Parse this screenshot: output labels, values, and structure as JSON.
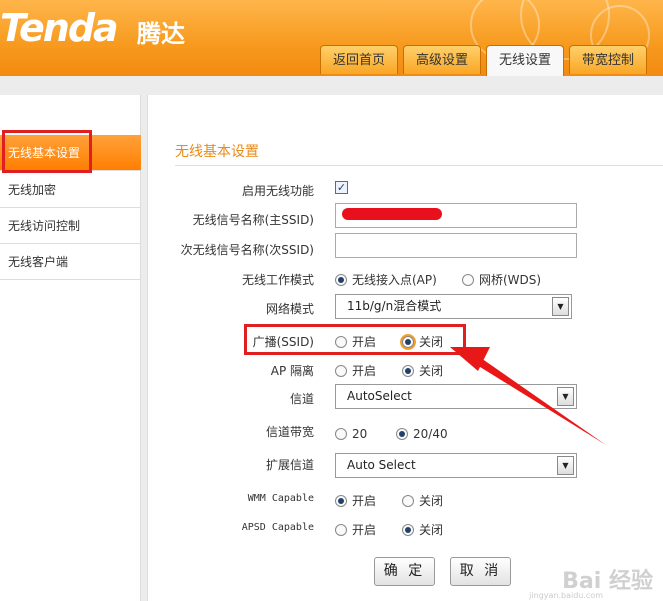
{
  "header": {
    "logo": "Tenda",
    "logo_cn": "腾达",
    "tabs": [
      "返回首页",
      "高级设置",
      "无线设置",
      "带宽控制"
    ],
    "active_tab": "无线设置"
  },
  "sidebar": {
    "items": [
      "无线基本设置",
      "无线加密",
      "无线访问控制",
      "无线客户端"
    ],
    "active": "无线基本设置"
  },
  "main": {
    "title": "无线基本设置",
    "enable_wireless": {
      "label": "启用无线功能",
      "checked": true,
      "mark": "✓"
    },
    "ssid_primary": {
      "label": "无线信号名称(主SSID)",
      "value": ""
    },
    "ssid_secondary": {
      "label": "次无线信号名称(次SSID)",
      "value": ""
    },
    "work_mode": {
      "label": "无线工作模式",
      "options": [
        "无线接入点(AP)",
        "网桥(WDS)"
      ],
      "selected": "无线接入点(AP)"
    },
    "network_mode": {
      "label": "网络模式",
      "value": "11b/g/n混合模式"
    },
    "broadcast": {
      "label": "广播(SSID)",
      "options": [
        "开启",
        "关闭"
      ],
      "selected": "关闭"
    },
    "ap_isolation": {
      "label": "AP 隔离",
      "options": [
        "开启",
        "关闭"
      ],
      "selected": "关闭"
    },
    "channel": {
      "label": "信道",
      "value": "AutoSelect"
    },
    "bandwidth": {
      "label": "信道带宽",
      "options": [
        "20",
        "20/40"
      ],
      "selected": "20/40"
    },
    "ext_channel": {
      "label": "扩展信道",
      "value": "Auto Select"
    },
    "wmm": {
      "label": "WMM Capable",
      "options": [
        "开启",
        "关闭"
      ],
      "selected": "开启"
    },
    "apsd": {
      "label": "APSD Capable",
      "options": [
        "开启",
        "关闭"
      ],
      "selected": "关闭"
    },
    "buttons": {
      "ok": "确 定",
      "cancel": "取 消"
    }
  },
  "watermark": {
    "brand": "Bai  经验",
    "url": "jingyan.baidu.com"
  },
  "colors": {
    "accent": "#f79a1e",
    "highlight": "#e02020",
    "title": "#e88a17"
  }
}
